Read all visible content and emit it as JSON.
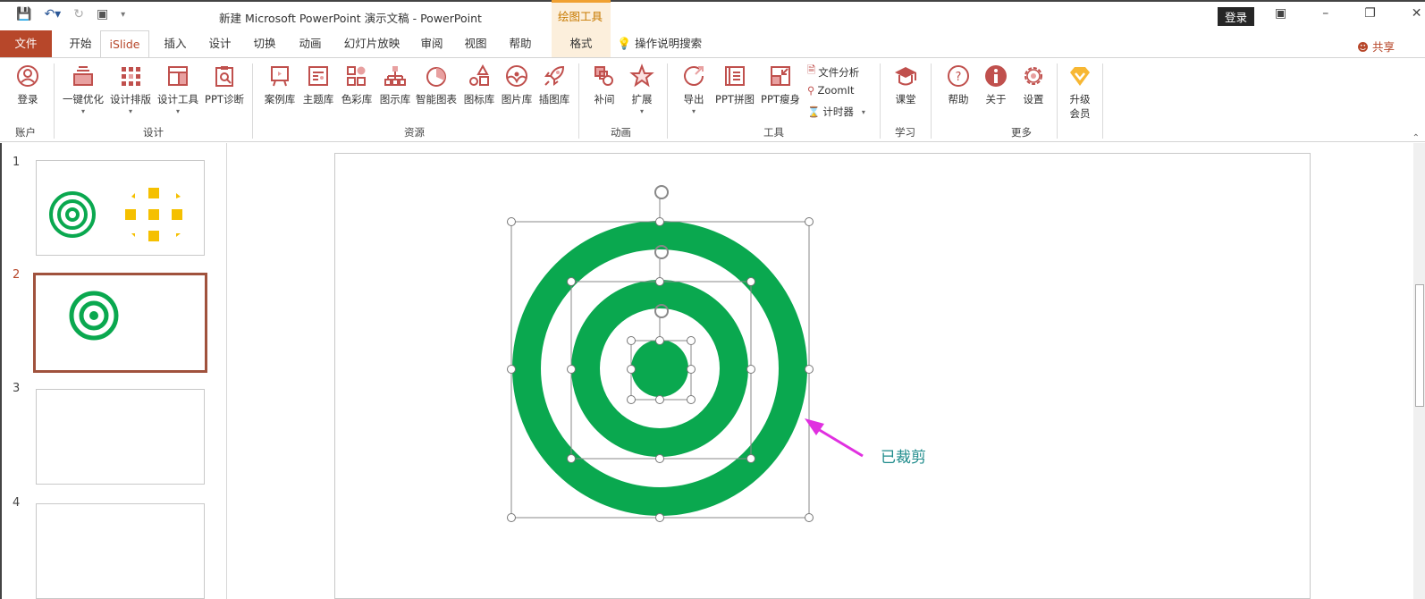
{
  "window": {
    "title": "新建 Microsoft PowerPoint 演示文稿  -  PowerPoint",
    "context_tool_label": "绘图工具",
    "login_button": "登录",
    "window_controls": [
      "ribbon-display-icon",
      "minimize-icon",
      "restore-icon",
      "close-icon"
    ]
  },
  "quick_access": [
    "save-icon",
    "undo-icon",
    "redo-icon",
    "present-icon",
    "customize-icon"
  ],
  "tabs": [
    {
      "label": "文件"
    },
    {
      "label": "开始"
    },
    {
      "label": "iSlide"
    },
    {
      "label": "插入"
    },
    {
      "label": "设计"
    },
    {
      "label": "切换"
    },
    {
      "label": "动画"
    },
    {
      "label": "幻灯片放映"
    },
    {
      "label": "审阅"
    },
    {
      "label": "视图"
    },
    {
      "label": "帮助"
    },
    {
      "label": "格式"
    }
  ],
  "tell_me": "操作说明搜索",
  "share": "共享",
  "ribbon": {
    "groups": {
      "account": "账户",
      "design": "设计",
      "resources": "资源",
      "animation": "动画",
      "tools": "工具",
      "learn": "学习",
      "more": "更多"
    },
    "buttons": {
      "login": "登录",
      "optimize": "一键优化",
      "layout": "设计排版",
      "design_tools": "设计工具",
      "ppt_diag": "PPT诊断",
      "cases": "案例库",
      "themes": "主题库",
      "colors": "色彩库",
      "diagrams": "图示库",
      "smart_charts": "智能图表",
      "icons": "图标库",
      "pictures": "图片库",
      "illustrations": "插图库",
      "tween": "补间",
      "extend": "扩展",
      "export": "导出",
      "ppt_merge": "PPT拼图",
      "ppt_slim": "PPT瘦身",
      "file_analysis": "文件分析",
      "zoomit": "ZoomIt",
      "timer": "计时器",
      "classroom": "课堂",
      "help": "帮助",
      "about": "关于",
      "settings": "设置",
      "upgrade_line1": "升级",
      "upgrade_line2": "会员"
    }
  },
  "slides": [
    {
      "number": "1"
    },
    {
      "number": "2",
      "selected": true
    },
    {
      "number": "3"
    },
    {
      "number": "4"
    }
  ],
  "annotation": {
    "text": "已裁剪"
  },
  "colors": {
    "accent": "#b7472a",
    "ring_green": "#0aa84f",
    "thumb_yellow": "#f5c000",
    "arrow_magenta": "#e030e0",
    "annotation_teal": "#1e8b8b"
  }
}
